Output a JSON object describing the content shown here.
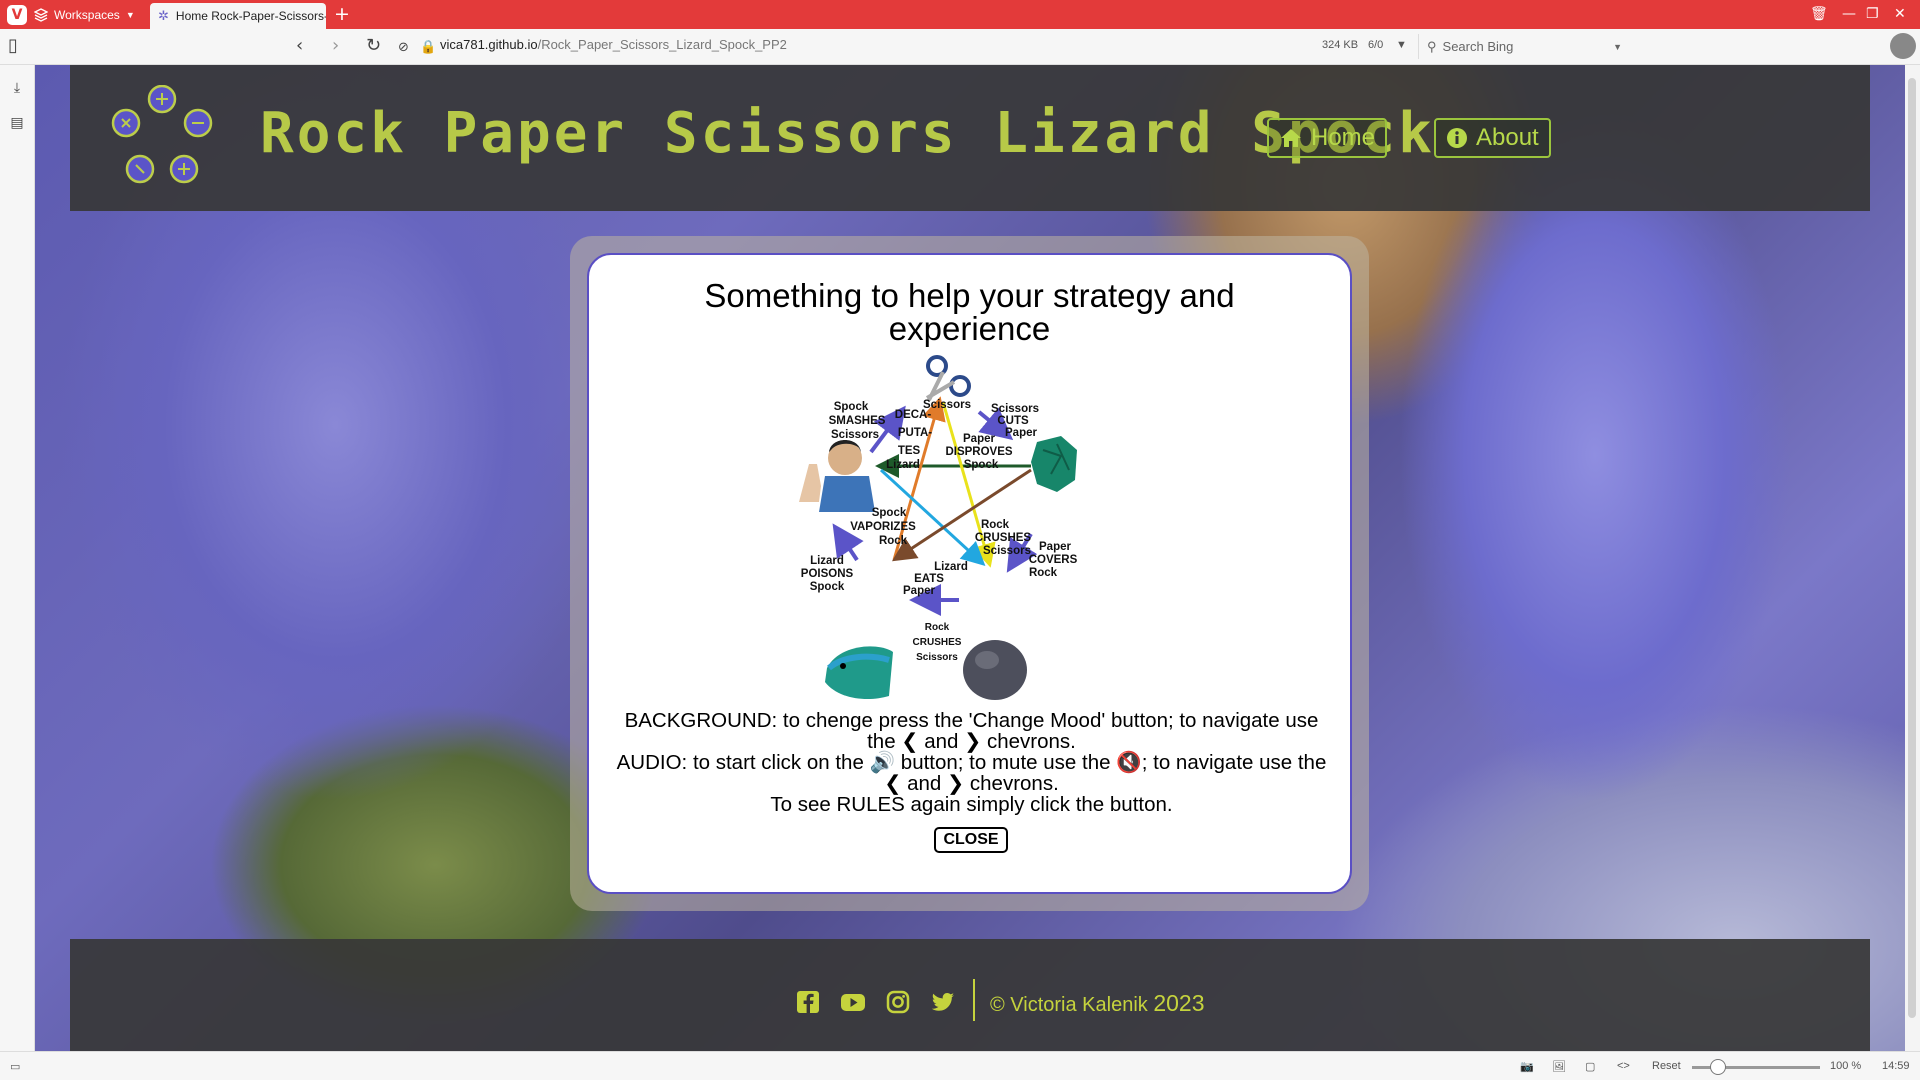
{
  "browser": {
    "workspaces_label": "Workspaces",
    "tab_title": "Home Rock-Paper-Scissors-",
    "url_host": "vica781.github.io",
    "url_path": "/Rock_Paper_Scissors_Lizard_Spock_PP2",
    "page_size": "324 KB",
    "counter": "6/0",
    "search_placeholder": "Search Bing",
    "reset_label": "Reset",
    "zoom_level": 50,
    "zoom_label": "100 %",
    "clock": "14:59"
  },
  "header": {
    "title": "Rock Paper Scissors Lizard Spock",
    "nav": [
      {
        "label": "Home",
        "icon": "home-icon"
      },
      {
        "label": "About",
        "icon": "info-icon"
      }
    ]
  },
  "modal": {
    "title": "Something to help your strategy and experience",
    "diagram_labels": {
      "scissors": "Scissors",
      "scissors_cuts_paper": [
        "Scissors",
        "CUTS",
        "Paper"
      ],
      "spock_smashes_scissors": [
        "Spock",
        "SMASHES",
        "Scissors"
      ],
      "scissors_decapitates_lizard": [
        "Scissors",
        "DECA-",
        "PUTA-",
        "TES",
        "Lizard"
      ],
      "paper_disproves_spock": [
        "Paper",
        "DISPROVES",
        "Spock"
      ],
      "rock_crushes_scissors_center": [
        "Rock",
        "CRUSHES",
        "Scissors"
      ],
      "spock_vaporizes_rock": [
        "Spock",
        "VAPORIZES",
        "Rock"
      ],
      "paper_covers_rock": [
        "Paper",
        "COVERS",
        "Rock"
      ],
      "lizard_eats_paper": [
        "Lizard",
        "EATS",
        "Paper"
      ],
      "lizard_poisons_spock": [
        "Lizard",
        "POISONS",
        "Spock"
      ],
      "rock_crushes_lizard": [
        "Rock",
        "CRUSHES",
        "Scissors"
      ]
    },
    "instructions": {
      "background_a": "BACKGROUND: to chenge press the 'Change Mood' button; to navigate use the",
      "and": "and",
      "chevrons": "chevrons.",
      "audio_a": "AUDIO: to start click on the",
      "audio_b": "button; to mute use the",
      "audio_c": "; to navigate use the",
      "rules": "To see RULES again simply click the button."
    },
    "close_label": "CLOSE"
  },
  "footer": {
    "social": [
      "facebook-icon",
      "youtube-icon",
      "instagram-icon",
      "twitter-icon"
    ],
    "copyright": "© Victoria Kalenik",
    "year": "2023"
  },
  "colors": {
    "accent": "#c5d33d",
    "title": "#b7c948",
    "modal_border": "#5a4fc4",
    "arrow_blue": "#5b54c8",
    "tabbar": "#e33a3a"
  }
}
